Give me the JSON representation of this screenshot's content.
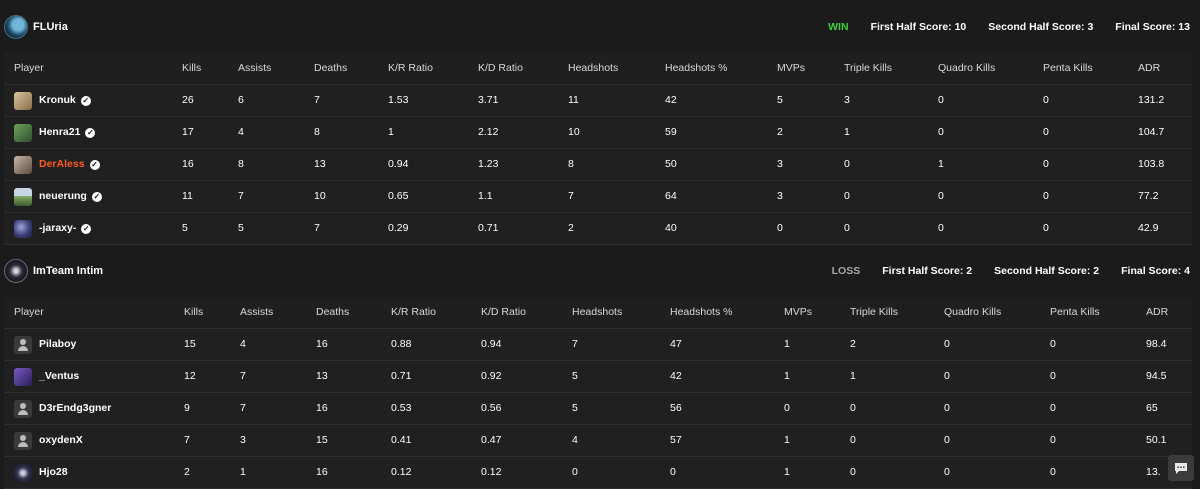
{
  "columns": [
    "Player",
    "Kills",
    "Assists",
    "Deaths",
    "K/R Ratio",
    "K/D Ratio",
    "Headshots",
    "Headshots %",
    "MVPs",
    "Triple Kills",
    "Quadro Kills",
    "Penta Kills",
    "ADR"
  ],
  "teams": [
    {
      "name": "FLUria",
      "result": "WIN",
      "first_half": "First Half Score: 10",
      "second_half": "Second Half Score: 3",
      "final": "Final Score: 13",
      "players": [
        {
          "name": "Kronuk",
          "avatar": "av-1",
          "verified": true,
          "stats": [
            "26",
            "6",
            "7",
            "1.53",
            "3.71",
            "11",
            "42",
            "5",
            "3",
            "0",
            "0",
            "131.2"
          ]
        },
        {
          "name": "Henra21",
          "avatar": "av-2",
          "verified": true,
          "stats": [
            "17",
            "4",
            "8",
            "1",
            "2.12",
            "10",
            "59",
            "2",
            "1",
            "0",
            "0",
            "104.7"
          ]
        },
        {
          "name": "DerAless",
          "avatar": "av-3",
          "verified": true,
          "highlight": true,
          "stats": [
            "16",
            "8",
            "13",
            "0.94",
            "1.23",
            "8",
            "50",
            "3",
            "0",
            "1",
            "0",
            "103.8"
          ]
        },
        {
          "name": "neuerung",
          "avatar": "av-4",
          "verified": true,
          "stats": [
            "11",
            "7",
            "10",
            "0.65",
            "1.1",
            "7",
            "64",
            "3",
            "0",
            "0",
            "0",
            "77.2"
          ]
        },
        {
          "name": "-jaraxy-",
          "avatar": "av-5",
          "verified": true,
          "stats": [
            "5",
            "5",
            "7",
            "0.29",
            "0.71",
            "2",
            "40",
            "0",
            "0",
            "0",
            "0",
            "42.9"
          ]
        }
      ]
    },
    {
      "name": "ImTeam Intim",
      "result": "LOSS",
      "first_half": "First Half Score: 2",
      "second_half": "Second Half Score: 2",
      "final": "Final Score: 4",
      "players": [
        {
          "name": "Pilaboy",
          "avatar": "av-default",
          "verified": false,
          "stats": [
            "15",
            "4",
            "16",
            "0.88",
            "0.94",
            "7",
            "47",
            "1",
            "2",
            "0",
            "0",
            "98.4"
          ]
        },
        {
          "name": "_Ventus",
          "avatar": "av-6",
          "verified": false,
          "stats": [
            "12",
            "7",
            "13",
            "0.71",
            "0.92",
            "5",
            "42",
            "1",
            "1",
            "0",
            "0",
            "94.5"
          ]
        },
        {
          "name": "D3rEndg3gner",
          "avatar": "av-default",
          "verified": false,
          "stats": [
            "9",
            "7",
            "16",
            "0.53",
            "0.56",
            "5",
            "56",
            "0",
            "0",
            "0",
            "0",
            "65"
          ]
        },
        {
          "name": "oxydenX",
          "avatar": "av-default",
          "verified": false,
          "stats": [
            "7",
            "3",
            "15",
            "0.41",
            "0.47",
            "4",
            "57",
            "1",
            "0",
            "0",
            "0",
            "50.1"
          ]
        },
        {
          "name": "Hjo28",
          "avatar": "av-7",
          "verified": false,
          "stats": [
            "2",
            "1",
            "16",
            "0.12",
            "0.12",
            "0",
            "0",
            "1",
            "0",
            "0",
            "0",
            "13."
          ]
        }
      ]
    }
  ],
  "colors": {
    "win": "#3fd13a",
    "loss": "#a8a8a8",
    "highlight": "#ff5a1f"
  },
  "icons": {
    "verified": "verified-check-icon",
    "chat": "chat-icon"
  }
}
